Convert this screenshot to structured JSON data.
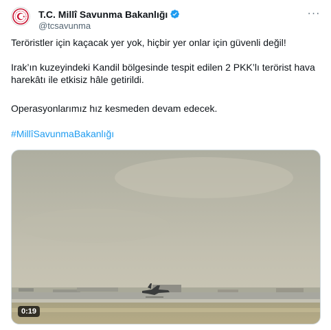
{
  "author": {
    "display_name": "T.C. Millî Savunma Bakanlığı",
    "handle": "@tcsavunma",
    "verified_icon": "verified-badge-icon",
    "verified_color": "#1d9bf0"
  },
  "more_icon": "more-options-icon",
  "more_label": "···",
  "tweet": {
    "paragraph_1": "Teröristler için kaçacak yer yok, hiçbir yer onlar için güvenli değil!",
    "paragraph_2": "Irak’ın kuzeyindeki Kandil bölgesinde tespit edilen 2 PKK’lı terörist hava harekâtı ile etkisiz hâle getirildi.",
    "paragraph_3": "Operasyonlarımız hız kesmeden devam edecek.",
    "hashtag": "#MillîSavunmaBakanlığı"
  },
  "media": {
    "duration": "0:19"
  },
  "colors": {
    "text": "#0f1419",
    "secondary": "#536471",
    "link": "#1d9bf0"
  }
}
